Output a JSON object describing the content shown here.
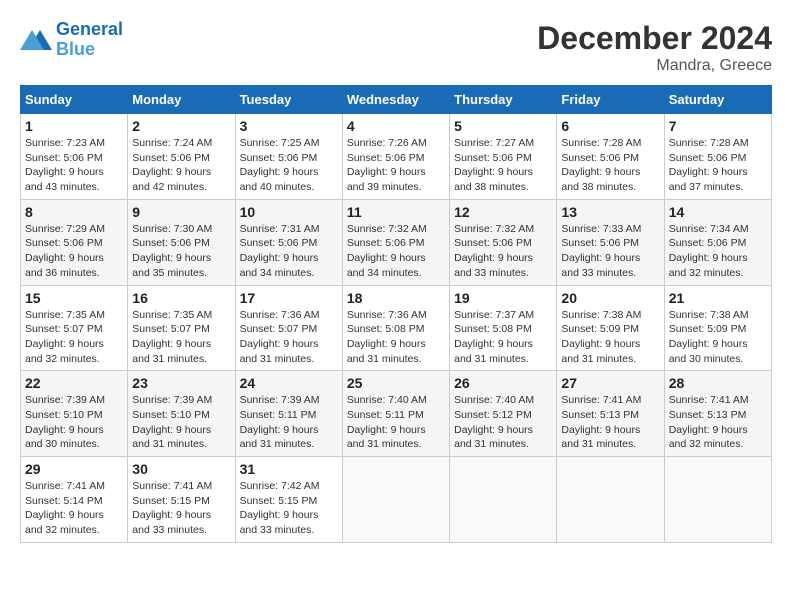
{
  "header": {
    "logo_line1": "General",
    "logo_line2": "Blue",
    "month": "December 2024",
    "location": "Mandra, Greece"
  },
  "weekdays": [
    "Sunday",
    "Monday",
    "Tuesday",
    "Wednesday",
    "Thursday",
    "Friday",
    "Saturday"
  ],
  "weeks": [
    [
      {
        "day": "1",
        "info": "Sunrise: 7:23 AM\nSunset: 5:06 PM\nDaylight: 9 hours\nand 43 minutes."
      },
      {
        "day": "2",
        "info": "Sunrise: 7:24 AM\nSunset: 5:06 PM\nDaylight: 9 hours\nand 42 minutes."
      },
      {
        "day": "3",
        "info": "Sunrise: 7:25 AM\nSunset: 5:06 PM\nDaylight: 9 hours\nand 40 minutes."
      },
      {
        "day": "4",
        "info": "Sunrise: 7:26 AM\nSunset: 5:06 PM\nDaylight: 9 hours\nand 39 minutes."
      },
      {
        "day": "5",
        "info": "Sunrise: 7:27 AM\nSunset: 5:06 PM\nDaylight: 9 hours\nand 38 minutes."
      },
      {
        "day": "6",
        "info": "Sunrise: 7:28 AM\nSunset: 5:06 PM\nDaylight: 9 hours\nand 38 minutes."
      },
      {
        "day": "7",
        "info": "Sunrise: 7:28 AM\nSunset: 5:06 PM\nDaylight: 9 hours\nand 37 minutes."
      }
    ],
    [
      {
        "day": "8",
        "info": "Sunrise: 7:29 AM\nSunset: 5:06 PM\nDaylight: 9 hours\nand 36 minutes."
      },
      {
        "day": "9",
        "info": "Sunrise: 7:30 AM\nSunset: 5:06 PM\nDaylight: 9 hours\nand 35 minutes."
      },
      {
        "day": "10",
        "info": "Sunrise: 7:31 AM\nSunset: 5:06 PM\nDaylight: 9 hours\nand 34 minutes."
      },
      {
        "day": "11",
        "info": "Sunrise: 7:32 AM\nSunset: 5:06 PM\nDaylight: 9 hours\nand 34 minutes."
      },
      {
        "day": "12",
        "info": "Sunrise: 7:32 AM\nSunset: 5:06 PM\nDaylight: 9 hours\nand 33 minutes."
      },
      {
        "day": "13",
        "info": "Sunrise: 7:33 AM\nSunset: 5:06 PM\nDaylight: 9 hours\nand 33 minutes."
      },
      {
        "day": "14",
        "info": "Sunrise: 7:34 AM\nSunset: 5:06 PM\nDaylight: 9 hours\nand 32 minutes."
      }
    ],
    [
      {
        "day": "15",
        "info": "Sunrise: 7:35 AM\nSunset: 5:07 PM\nDaylight: 9 hours\nand 32 minutes."
      },
      {
        "day": "16",
        "info": "Sunrise: 7:35 AM\nSunset: 5:07 PM\nDaylight: 9 hours\nand 31 minutes."
      },
      {
        "day": "17",
        "info": "Sunrise: 7:36 AM\nSunset: 5:07 PM\nDaylight: 9 hours\nand 31 minutes."
      },
      {
        "day": "18",
        "info": "Sunrise: 7:36 AM\nSunset: 5:08 PM\nDaylight: 9 hours\nand 31 minutes."
      },
      {
        "day": "19",
        "info": "Sunrise: 7:37 AM\nSunset: 5:08 PM\nDaylight: 9 hours\nand 31 minutes."
      },
      {
        "day": "20",
        "info": "Sunrise: 7:38 AM\nSunset: 5:09 PM\nDaylight: 9 hours\nand 31 minutes."
      },
      {
        "day": "21",
        "info": "Sunrise: 7:38 AM\nSunset: 5:09 PM\nDaylight: 9 hours\nand 30 minutes."
      }
    ],
    [
      {
        "day": "22",
        "info": "Sunrise: 7:39 AM\nSunset: 5:10 PM\nDaylight: 9 hours\nand 30 minutes."
      },
      {
        "day": "23",
        "info": "Sunrise: 7:39 AM\nSunset: 5:10 PM\nDaylight: 9 hours\nand 31 minutes."
      },
      {
        "day": "24",
        "info": "Sunrise: 7:39 AM\nSunset: 5:11 PM\nDaylight: 9 hours\nand 31 minutes."
      },
      {
        "day": "25",
        "info": "Sunrise: 7:40 AM\nSunset: 5:11 PM\nDaylight: 9 hours\nand 31 minutes."
      },
      {
        "day": "26",
        "info": "Sunrise: 7:40 AM\nSunset: 5:12 PM\nDaylight: 9 hours\nand 31 minutes."
      },
      {
        "day": "27",
        "info": "Sunrise: 7:41 AM\nSunset: 5:13 PM\nDaylight: 9 hours\nand 31 minutes."
      },
      {
        "day": "28",
        "info": "Sunrise: 7:41 AM\nSunset: 5:13 PM\nDaylight: 9 hours\nand 32 minutes."
      }
    ],
    [
      {
        "day": "29",
        "info": "Sunrise: 7:41 AM\nSunset: 5:14 PM\nDaylight: 9 hours\nand 32 minutes."
      },
      {
        "day": "30",
        "info": "Sunrise: 7:41 AM\nSunset: 5:15 PM\nDaylight: 9 hours\nand 33 minutes."
      },
      {
        "day": "31",
        "info": "Sunrise: 7:42 AM\nSunset: 5:15 PM\nDaylight: 9 hours\nand 33 minutes."
      },
      {
        "day": "",
        "info": ""
      },
      {
        "day": "",
        "info": ""
      },
      {
        "day": "",
        "info": ""
      },
      {
        "day": "",
        "info": ""
      }
    ]
  ]
}
